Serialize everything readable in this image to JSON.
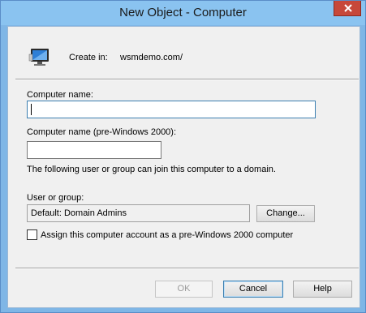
{
  "window": {
    "title": "New Object - Computer"
  },
  "header": {
    "icon": "computer-icon",
    "create_in_label": "Create in:",
    "create_in_value": "wsmdemo.com/"
  },
  "form": {
    "computer_name_label": "Computer name:",
    "computer_name_value": "",
    "pre2000_label": "Computer name (pre-Windows 2000):",
    "pre2000_value": "",
    "join_info": "The following user or group can join this computer to a domain.",
    "user_group_label": "User or group:",
    "user_group_value": "Default: Domain Admins",
    "change_button": "Change...",
    "assign_checkbox_label": "Assign this computer account as a pre-Windows 2000 computer",
    "assign_checked": false
  },
  "buttons": {
    "ok": "OK",
    "cancel": "Cancel",
    "help": "Help"
  },
  "colors": {
    "title_bar": "#8ac3f0",
    "close_button": "#c7483a",
    "focus_border": "#3c7fb1"
  }
}
